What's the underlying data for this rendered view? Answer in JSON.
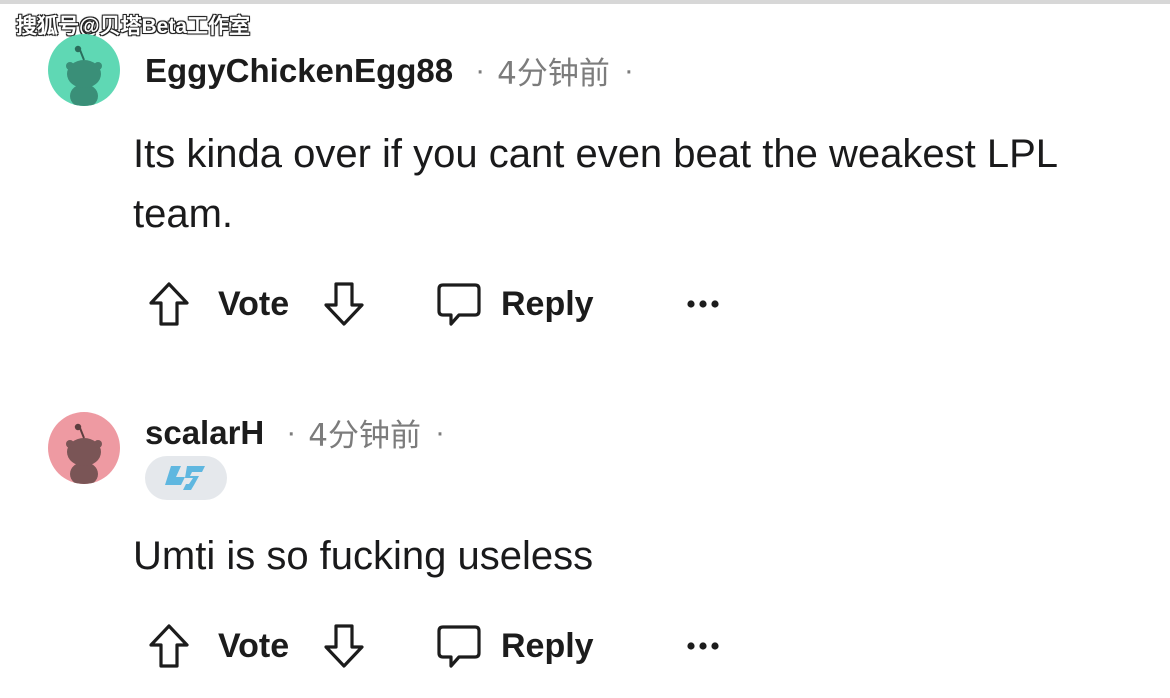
{
  "watermark": "搜狐号@贝塔Beta工作室",
  "comments": [
    {
      "username": "EggyChickenEgg88",
      "separator": "·",
      "time": "4分钟前",
      "text": "Its kinda over if you cant even beat the weakest LPL team.",
      "avatar_color": "#5fd8b4",
      "actions": {
        "vote_label": "Vote",
        "reply_label": "Reply"
      }
    },
    {
      "username": "scalarH",
      "separator": "·",
      "time": "4分钟前",
      "text": "Umti is so fucking useless",
      "avatar_color": "#ee9aa2",
      "flair_icon": "clg-logo-icon",
      "actions": {
        "vote_label": "Vote",
        "reply_label": "Reply"
      }
    }
  ],
  "icons": {
    "upvote": "arrow-up-icon",
    "downvote": "arrow-down-icon",
    "reply": "speech-bubble-icon",
    "more": "ellipsis-icon"
  }
}
